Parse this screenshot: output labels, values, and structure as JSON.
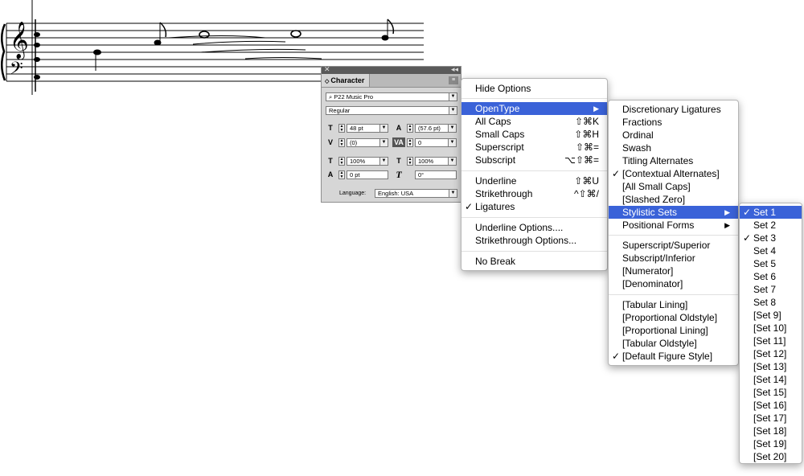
{
  "panel": {
    "tab_label": "Character",
    "font_family": "P22 Music Pro",
    "font_style": "Regular",
    "font_size": "48 pt",
    "leading": "(57.6 pt)",
    "kerning": "(0)",
    "tracking": "0",
    "vertical_scale": "100%",
    "horizontal_scale": "100%",
    "baseline_shift": "0 pt",
    "skew": "0°",
    "language_label": "Language:",
    "language_value": "English: USA"
  },
  "menu_main": {
    "items": [
      {
        "label": "Hide Options",
        "shortcut": "",
        "checked": false
      },
      {
        "label": "OpenType",
        "shortcut": "",
        "submenu": true,
        "highlighted": true
      },
      {
        "label": "All Caps",
        "shortcut": "⇧⌘K"
      },
      {
        "label": "Small Caps",
        "shortcut": "⇧⌘H"
      },
      {
        "label": "Superscript",
        "shortcut": "⇧⌘="
      },
      {
        "label": "Subscript",
        "shortcut": "⌥⇧⌘="
      },
      {
        "label": "Underline",
        "shortcut": "⇧⌘U"
      },
      {
        "label": "Strikethrough",
        "shortcut": "^⇧⌘/"
      },
      {
        "label": "Ligatures",
        "shortcut": "",
        "checked": true
      },
      {
        "label": "Underline Options....",
        "shortcut": ""
      },
      {
        "label": "Strikethrough Options...",
        "shortcut": ""
      },
      {
        "label": "No Break",
        "shortcut": ""
      }
    ]
  },
  "menu_opentype": {
    "items": [
      {
        "label": "Discretionary Ligatures"
      },
      {
        "label": "Fractions"
      },
      {
        "label": "Ordinal"
      },
      {
        "label": "Swash"
      },
      {
        "label": "Titling Alternates"
      },
      {
        "label": "[Contextual Alternates]",
        "checked": true
      },
      {
        "label": "[All Small Caps]"
      },
      {
        "label": "[Slashed Zero]"
      },
      {
        "label": "Stylistic Sets",
        "submenu": true,
        "highlighted": true
      },
      {
        "label": "Positional Forms",
        "submenu": true
      },
      {
        "label": "Superscript/Superior"
      },
      {
        "label": "Subscript/Inferior"
      },
      {
        "label": "[Numerator]"
      },
      {
        "label": "[Denominator]"
      },
      {
        "label": "[Tabular Lining]"
      },
      {
        "label": "[Proportional Oldstyle]"
      },
      {
        "label": "[Proportional Lining]"
      },
      {
        "label": "[Tabular Oldstyle]"
      },
      {
        "label": "[Default Figure Style]",
        "checked": true
      }
    ]
  },
  "menu_stylistic": {
    "items": [
      {
        "label": "Set 1",
        "checked": true,
        "highlighted": true
      },
      {
        "label": "Set 2"
      },
      {
        "label": "Set 3",
        "checked": true
      },
      {
        "label": "Set 4"
      },
      {
        "label": "Set 5"
      },
      {
        "label": "Set 6"
      },
      {
        "label": "Set 7"
      },
      {
        "label": "Set 8"
      },
      {
        "label": "[Set 9]"
      },
      {
        "label": "[Set 10]"
      },
      {
        "label": "[Set 11]"
      },
      {
        "label": "[Set 12]"
      },
      {
        "label": "[Set 13]"
      },
      {
        "label": "[Set 14]"
      },
      {
        "label": "[Set 15]"
      },
      {
        "label": "[Set 16]"
      },
      {
        "label": "[Set 17]"
      },
      {
        "label": "[Set 18]"
      },
      {
        "label": "[Set 19]"
      },
      {
        "label": "[Set 20]"
      }
    ]
  },
  "glyphs": {
    "check": "✓",
    "submenu_arrow": "▶",
    "close": "✕",
    "collapse": "◂◂",
    "dropdown": "▼",
    "panel_menu": "≡",
    "tab_arrows": "◇",
    "search": "⌕",
    "treble_clef": "𝄞",
    "bass_clef": "𝄢"
  },
  "colors": {
    "highlight": "#3a62d8",
    "panel_bg": "#d6d6d6"
  }
}
